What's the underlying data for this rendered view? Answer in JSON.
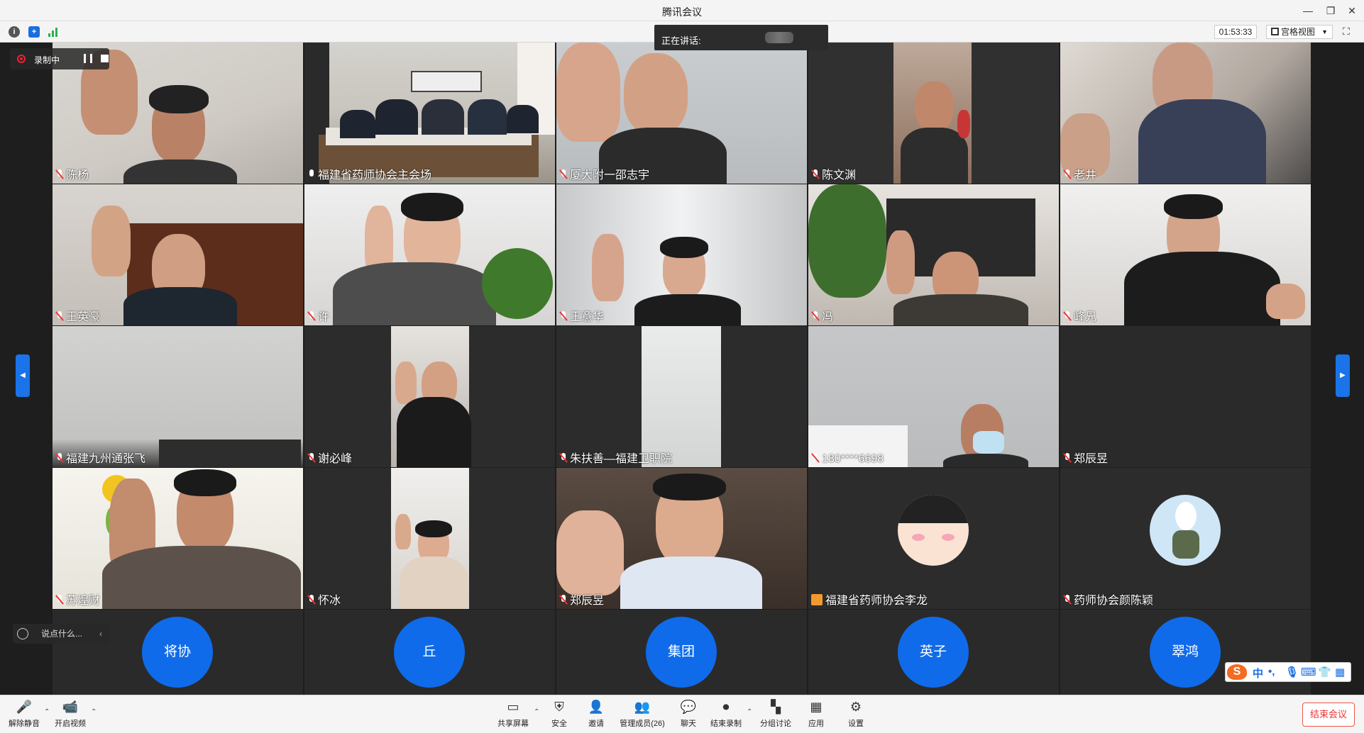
{
  "window": {
    "title": "腾讯会议"
  },
  "infobar": {
    "timer": "01:53:33",
    "view_label": "宫格视图"
  },
  "speaking": {
    "label": "正在讲话:"
  },
  "recording": {
    "label": "录制中"
  },
  "participants": [
    {
      "name": "陈杨",
      "muted": true
    },
    {
      "name": "福建省药师协会主会场",
      "muted": false
    },
    {
      "name": "厦大附一邵志宇",
      "muted": true
    },
    {
      "name": "陈文渊",
      "muted": true
    },
    {
      "name": "老井",
      "muted": true
    },
    {
      "name": "王英豪",
      "muted": true
    },
    {
      "name": "许",
      "muted": true
    },
    {
      "name": "王意华",
      "muted": true
    },
    {
      "name": "冯",
      "muted": true
    },
    {
      "name": "峰兄",
      "muted": true
    },
    {
      "name": "福建九州通张飞",
      "muted": true
    },
    {
      "name": "谢必峰",
      "muted": true
    },
    {
      "name": "朱扶善—福建卫职院",
      "muted": true
    },
    {
      "name": "180****6698",
      "muted": true
    },
    {
      "name": "郑辰昱",
      "muted": true
    },
    {
      "name": "苏煌财",
      "muted": true
    },
    {
      "name": "怀冰",
      "muted": true
    },
    {
      "name": "郑辰昱",
      "muted": true
    },
    {
      "name": "福建省药师协会李龙",
      "muted": false
    },
    {
      "name": "药师协会颜陈颖",
      "muted": true
    }
  ],
  "avatars": [
    "将协",
    "丘",
    "集团",
    "英子",
    "翠鸿"
  ],
  "chat": {
    "placeholder": "说点什么..."
  },
  "ime": {
    "mode": "中",
    "punct": "•,",
    "logo": "S"
  },
  "toolbar": {
    "unmute": "解除静音",
    "start_video": "开启视频",
    "share": "共享屏幕",
    "security": "安全",
    "invite": "邀请",
    "members": "管理成员(26)",
    "chat": "聊天",
    "end_record": "结束录制",
    "breakout": "分组讨论",
    "apps": "应用",
    "settings": "设置",
    "end_meeting": "结束会议"
  },
  "colors": {
    "accent": "#0f6bea",
    "danger": "#e53333",
    "background": "#1e1e1e"
  }
}
